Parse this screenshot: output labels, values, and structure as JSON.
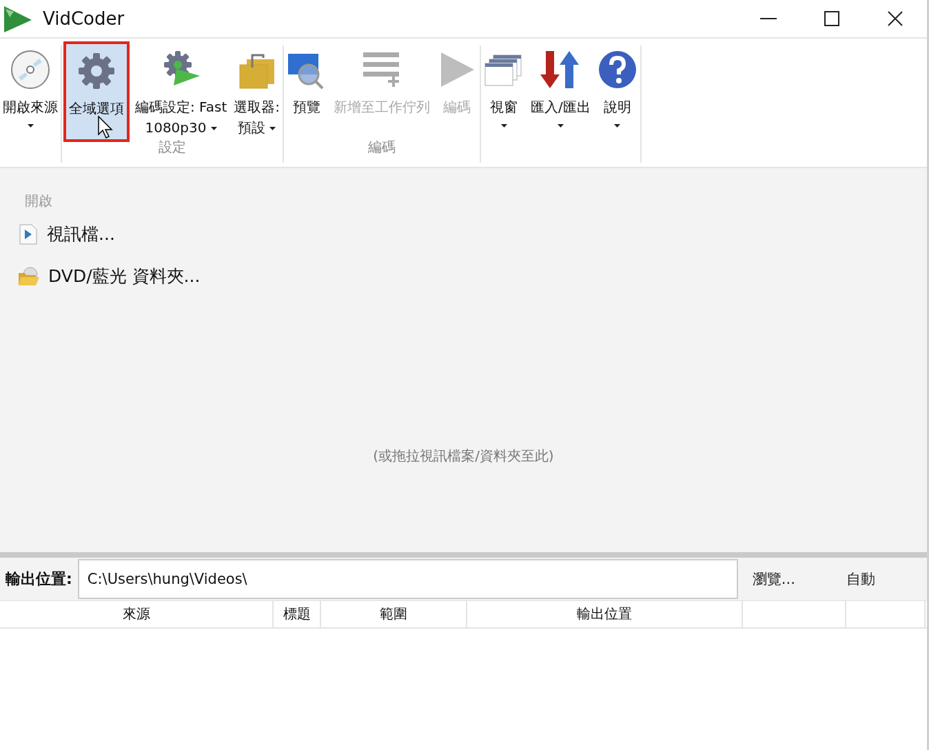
{
  "window": {
    "title": "VidCoder"
  },
  "ribbon": {
    "groups": [
      {
        "buttons": [
          {
            "label": "開啟來源",
            "dropdown": true,
            "disabled": false,
            "highlighted": false
          }
        ]
      },
      {
        "label": "設定",
        "buttons": [
          {
            "label": "全域選項",
            "dropdown": false,
            "disabled": false,
            "highlighted": true
          },
          {
            "label": "編碼設定: Fast\n1080p30",
            "dropdown": true,
            "disabled": false,
            "highlighted": false
          },
          {
            "label": "選取器:\n預設",
            "dropdown": true,
            "disabled": false,
            "highlighted": false
          }
        ]
      },
      {
        "label": "編碼",
        "buttons": [
          {
            "label": "預覽",
            "dropdown": false,
            "disabled": false,
            "highlighted": false
          },
          {
            "label": "新增至工作佇列",
            "dropdown": false,
            "disabled": true,
            "highlighted": false
          },
          {
            "label": "編碼",
            "dropdown": false,
            "disabled": true,
            "highlighted": false
          }
        ]
      },
      {
        "buttons": [
          {
            "label": "視窗",
            "dropdown": true,
            "disabled": false,
            "highlighted": false
          },
          {
            "label": "匯入/匯出",
            "dropdown": true,
            "disabled": false,
            "highlighted": false
          },
          {
            "label": "說明",
            "dropdown": true,
            "disabled": false,
            "highlighted": false
          }
        ]
      }
    ]
  },
  "open_panel": {
    "heading": "開啟",
    "items": [
      {
        "label": "視訊檔..."
      },
      {
        "label": "DVD/藍光 資料夾..."
      }
    ],
    "drop_hint": "(或拖拉視訊檔案/資料夾至此)"
  },
  "output": {
    "label": "輸出位置:",
    "value": "C:\\Users\\hung\\Videos\\",
    "browse": "瀏覽...",
    "auto": "自動"
  },
  "queue": {
    "columns": [
      "來源",
      "標題",
      "範圍",
      "輸出位置"
    ]
  }
}
